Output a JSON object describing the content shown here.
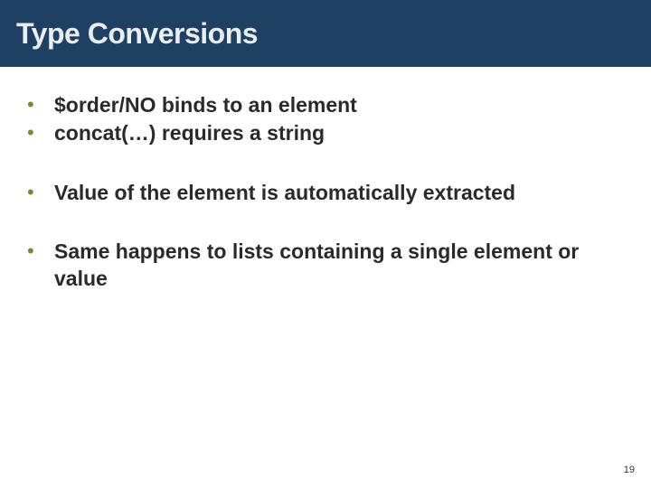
{
  "slide": {
    "title": "Type Conversions",
    "groups": [
      {
        "items": [
          "$order/NO binds to an element",
          "concat(…) requires a string"
        ]
      },
      {
        "items": [
          "Value of the element is automatically extracted"
        ]
      },
      {
        "items": [
          "Same happens to lists containing a single element or value"
        ]
      }
    ],
    "page_number": "19",
    "bullet_glyph": "•"
  }
}
